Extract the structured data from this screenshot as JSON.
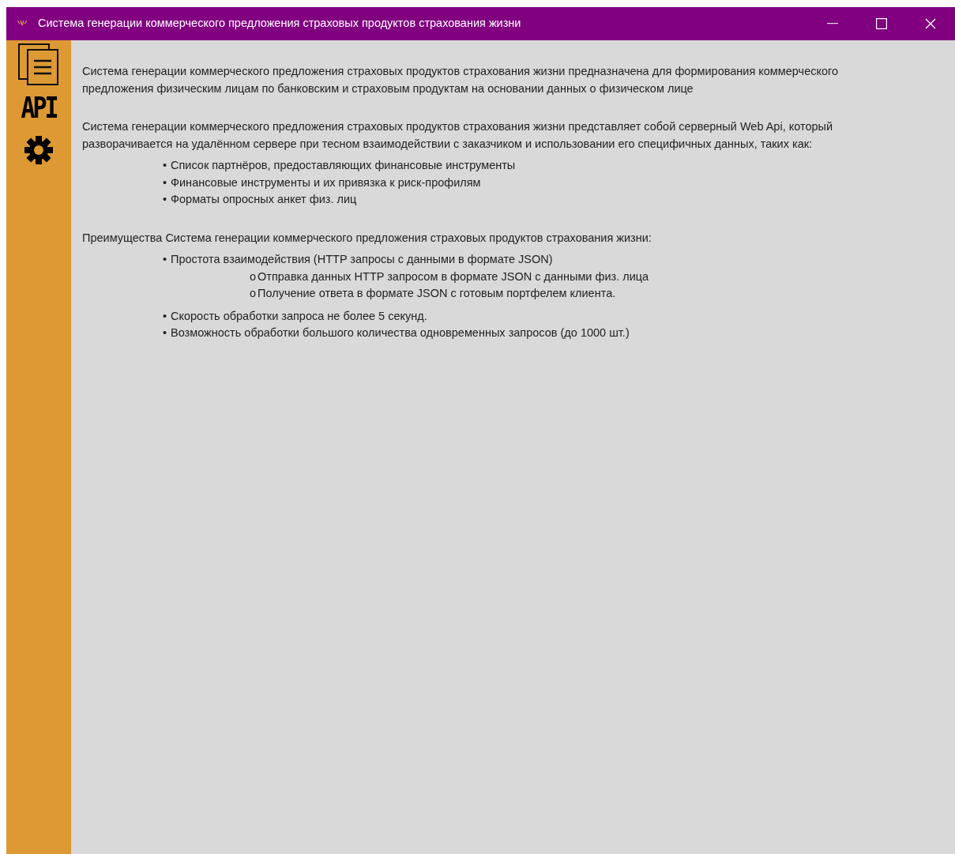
{
  "window": {
    "title": "Система генерации коммерческого предложения страховых продуктов страхования жизни"
  },
  "sidebar": {
    "items": [
      {
        "kind": "documents"
      },
      {
        "kind": "text",
        "label": "API"
      },
      {
        "kind": "gear"
      }
    ]
  },
  "content": [
    {
      "kind": "paragraph",
      "text": "Система генерации коммерческого предложения страховых продуктов страхования жизни предназначена для формирования коммерческого предложения физическим лицам по банковским и страховым продуктам на основании данных о физическом лице"
    },
    {
      "kind": "paragraph",
      "text": "Система генерации коммерческого предложения страховых продуктов страхования жизни представляет собой серверный Web Api, который разворачивается на удалённом сервере при тесном взаимодействии с заказчиком и использовании его специфичных данных, таких как:",
      "items": [
        {
          "marker": "•",
          "text": "Список партнёров, предоставляющих финансовые инструменты"
        },
        {
          "marker": "•",
          "text": "Финансовые инструменты и их привязка к риск-профилям"
        },
        {
          "marker": "•",
          "text": "Форматы опросных анкет физ. лиц"
        }
      ]
    },
    {
      "kind": "paragraph",
      "text": "Преимущества Система генерации коммерческого предложения страховых продуктов страхования жизни:",
      "items": [
        {
          "marker": "•",
          "text": "Простота взаимодействия (HTTP запросы с данными в формате JSON)",
          "children": [
            {
              "marker": "o",
              "text": "Отправка данных HTTP запросом в формате JSON с данными физ. лица"
            },
            {
              "marker": "o",
              "text": "Получение ответа в формате JSON с готовым портфелем клиента."
            }
          ]
        },
        {
          "marker": "•",
          "text": "Скорость обработки запроса не более 5 секунд."
        },
        {
          "marker": "•",
          "text": "Возможность обработки большого количества одновременных запросов (до 1000 шт.)"
        }
      ]
    }
  ]
}
